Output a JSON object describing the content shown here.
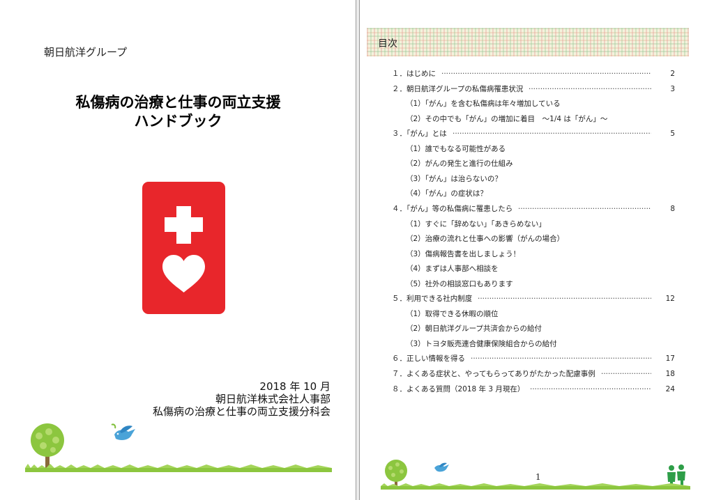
{
  "cover": {
    "group_name": "朝日航洋グループ",
    "title_line1": "私傷病の治療と仕事の両立支援",
    "title_line2": "ハンドブック",
    "date": "2018 年 10 月",
    "org": "朝日航洋株式会社人事部",
    "committee": "私傷病の治療と仕事の両立支援分科会",
    "card_color": "#e8262b"
  },
  "toc": {
    "title": "目次",
    "page_number": "1",
    "entries": [
      {
        "label": "１．はじめに",
        "page": "2",
        "level": 1
      },
      {
        "label": "２．朝日航洋グループの私傷病罹患状況",
        "page": "3",
        "level": 1
      },
      {
        "label": "（1）「がん」を含む私傷病は年々増加している",
        "page": "",
        "level": 2
      },
      {
        "label": "（2）その中でも「がん」の増加に着目　～1/4 は「がん」～",
        "page": "",
        "level": 2
      },
      {
        "label": "３．「がん」とは",
        "page": "5",
        "level": 1
      },
      {
        "label": "（1）誰でもなる可能性がある",
        "page": "",
        "level": 2
      },
      {
        "label": "（2）がんの発生と進行の仕組み",
        "page": "",
        "level": 2
      },
      {
        "label": "（3）「がん」は治らないの？",
        "page": "",
        "level": 2
      },
      {
        "label": "（4）「がん」の症状は？",
        "page": "",
        "level": 2
      },
      {
        "label": "４．「がん」等の私傷病に罹患したら",
        "page": "8",
        "level": 1
      },
      {
        "label": "（1）すぐに「辞めない」「あきらめない」",
        "page": "",
        "level": 2
      },
      {
        "label": "（2）治療の流れと仕事への影響（がんの場合）",
        "page": "",
        "level": 2
      },
      {
        "label": "（3）傷病報告書を出しましょう！",
        "page": "",
        "level": 2
      },
      {
        "label": "（4）まずは人事部へ相談を",
        "page": "",
        "level": 2
      },
      {
        "label": "（5）社外の相談窓口もあります",
        "page": "",
        "level": 2
      },
      {
        "label": "５．利用できる社内制度",
        "page": "12",
        "level": 1
      },
      {
        "label": "（1）取得できる休暇の順位",
        "page": "",
        "level": 2
      },
      {
        "label": "（2）朝日航洋グループ共済会からの給付",
        "page": "",
        "level": 2
      },
      {
        "label": "（3）トヨタ販売連合健康保険組合からの給付",
        "page": "",
        "level": 2
      },
      {
        "label": "６．正しい情報を得る",
        "page": "17",
        "level": 1
      },
      {
        "label": "７．よくある症状と、やってもらってありがたかった配慮事例",
        "page": "18",
        "level": 1
      },
      {
        "label": "８．よくある質問（2018 年 3 月現在）",
        "page": "24",
        "level": 1
      }
    ]
  }
}
